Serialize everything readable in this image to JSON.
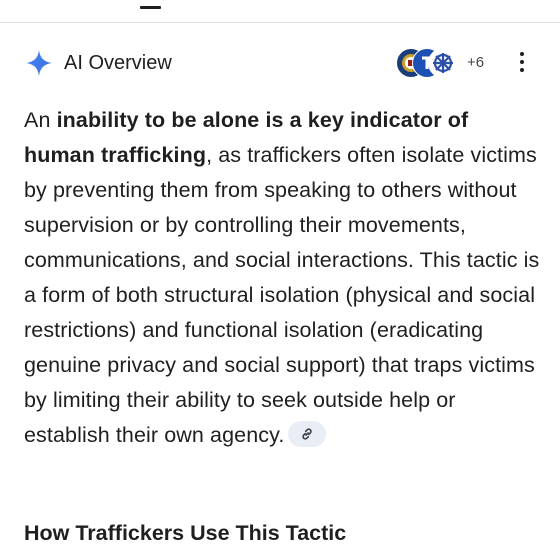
{
  "ai_overview": {
    "title": "AI Overview",
    "sources_more": "+6",
    "answer": {
      "intro": "An ",
      "bold_phrase": "inability to be alone is a key indicator of human trafficking",
      "body": ", as traffickers often isolate victims by preventing them from speaking to others without supervision or by controlling their movements, communications, and social interactions. This tactic is a form of both structural isolation (physical and social restrictions) and functional isolation (eradicating genuine privacy and social support) that traps victims by limiting their ability to seek outside help or establish their own agency."
    },
    "section_heading": "How Traffickers Use This Tactic"
  },
  "icons": {
    "sparkle": "gemini-sparkle-icon",
    "more": "more-vert-icon",
    "citation": "link-icon"
  },
  "colors": {
    "sparkle": "#4a7cf0",
    "chip_bg": "#e9eef6",
    "text": "#1f1f1f"
  }
}
